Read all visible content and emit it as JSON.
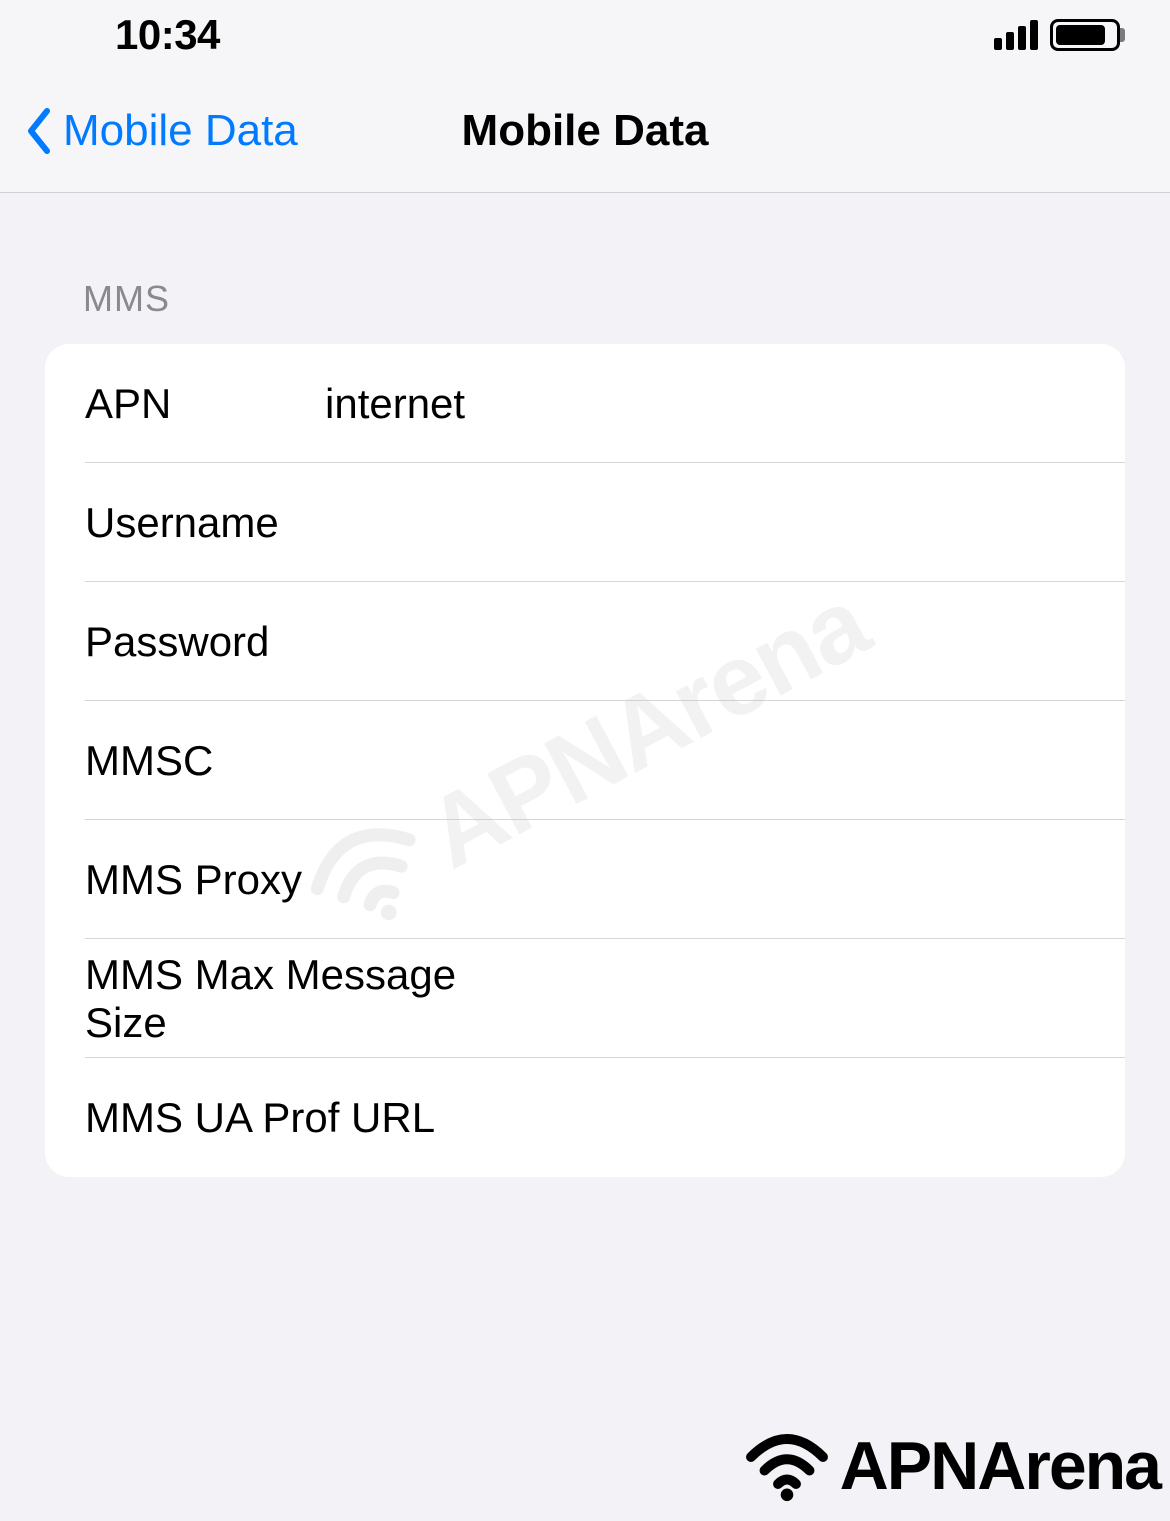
{
  "status": {
    "time": "10:34"
  },
  "nav": {
    "back_label": "Mobile Data",
    "title": "Mobile Data"
  },
  "section": {
    "header": "MMS",
    "rows": [
      {
        "label": "APN",
        "value": "internet"
      },
      {
        "label": "Username",
        "value": ""
      },
      {
        "label": "Password",
        "value": ""
      },
      {
        "label": "MMSC",
        "value": ""
      },
      {
        "label": "MMS Proxy",
        "value": ""
      },
      {
        "label": "MMS Max Message Size",
        "value": ""
      },
      {
        "label": "MMS UA Prof URL",
        "value": ""
      }
    ]
  },
  "watermark": "APNArena"
}
